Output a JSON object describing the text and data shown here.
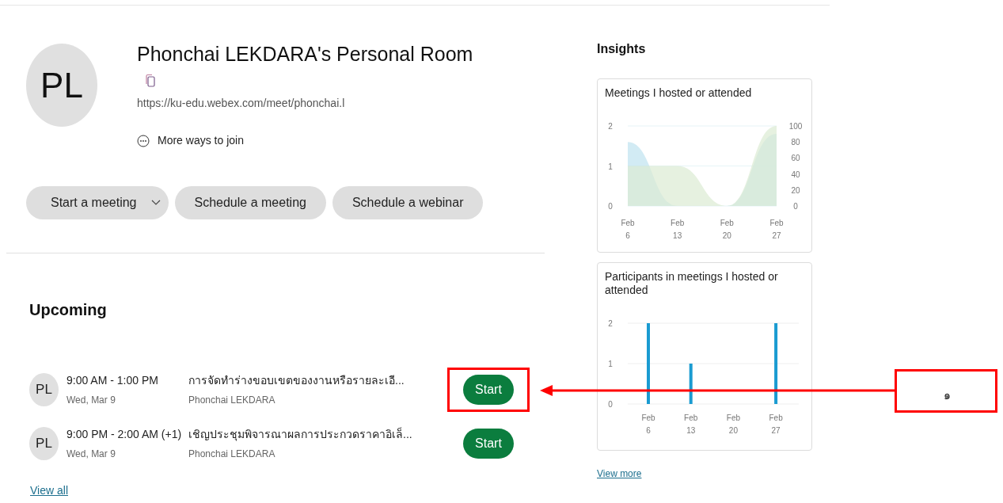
{
  "room": {
    "initials": "PL",
    "title": "Phonchai LEKDARA's Personal Room",
    "url": "https://ku-edu.webex.com/meet/phonchai.l",
    "more_ways": "More ways to join"
  },
  "actions": [
    {
      "label": "Start a meeting",
      "kind": "dropdown"
    },
    {
      "label": "Schedule a meeting",
      "kind": "plain"
    },
    {
      "label": "Schedule a webinar",
      "kind": "plain"
    }
  ],
  "upcoming": {
    "title": "Upcoming",
    "meetings": [
      {
        "initials": "PL",
        "time": "9:00 AM - 1:00 PM",
        "date": "Wed, Mar 9",
        "title": "การจัดทำร่างขอบเขตของงานหรือรายละเอี...",
        "host": "Phonchai LEKDARA",
        "button": "Start",
        "highlighted": true
      },
      {
        "initials": "PL",
        "time": "9:00 PM - 2:00 AM (+1)",
        "date": "Wed, Mar 9",
        "title": "เชิญประชุมพิจารณาผลการประกวดราคาอิเล็...",
        "host": "Phonchai LEKDARA",
        "button": "Start",
        "highlighted": false
      }
    ],
    "view_all": "View all"
  },
  "insights": {
    "title": "Insights",
    "cards": [
      {
        "title": "Meetings I hosted or attended",
        "right_axis": [
          "100",
          "80",
          "60",
          "40",
          "20",
          "0"
        ],
        "chart_data": {
          "type": "area",
          "categories": [
            "Feb 6",
            "Feb 13",
            "Feb 20",
            "Feb 27"
          ],
          "ylim": [
            0,
            2
          ],
          "yticks": [
            0,
            1,
            2
          ],
          "series": [
            {
              "color": "#bfe3f0",
              "values": [
                1.6,
                0,
                0,
                1.8
              ]
            },
            {
              "color": "#dcebd3",
              "values": [
                1,
                1,
                0,
                2
              ]
            }
          ]
        }
      },
      {
        "title": "Participants in meetings I hosted or attended",
        "chart_data": {
          "type": "bar",
          "categories": [
            "Feb 6",
            "Feb 13",
            "Feb 20",
            "Feb 27"
          ],
          "ylim": [
            0,
            2
          ],
          "yticks": [
            0,
            1,
            2
          ],
          "series": [
            {
              "color": "#1a9bd1",
              "values": [
                2,
                1,
                0,
                2
              ]
            }
          ]
        }
      }
    ],
    "view_more": "View more"
  },
  "callout": {
    "label": "๑"
  }
}
